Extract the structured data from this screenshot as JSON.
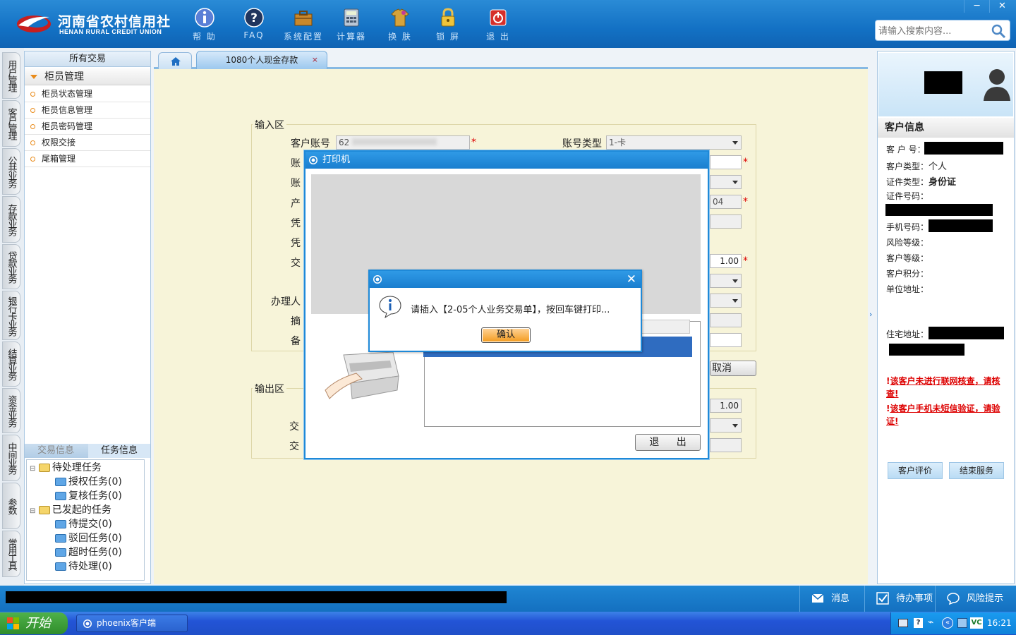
{
  "header": {
    "logo_cn": "河南省农村信用社",
    "logo_en": "HENAN RURAL CREDIT UNION",
    "buttons": [
      {
        "label": "帮 助",
        "icon": "info-icon"
      },
      {
        "label": "FAQ",
        "icon": "help-question-icon"
      },
      {
        "label": "系统配置",
        "icon": "toolbox-icon"
      },
      {
        "label": "计算器",
        "icon": "calculator-icon"
      },
      {
        "label": "换 肤",
        "icon": "shirt-icon"
      },
      {
        "label": "锁 屏",
        "icon": "lock-icon"
      },
      {
        "label": "退 出",
        "icon": "power-icon"
      }
    ],
    "window_controls": {
      "minimize": "─",
      "close": "✕"
    },
    "search_placeholder": "请输入搜索内容..."
  },
  "vtabs": [
    "用户管理",
    "客户管理",
    "公共业务",
    "存款业务",
    "贷款业务",
    "银行卡业务",
    "结算业务",
    "资金业务",
    "中间业务",
    "参数",
    "常用工具"
  ],
  "left_panel": {
    "header": "所有交易",
    "group": "柜员管理",
    "items": [
      "柜员状态管理",
      "柜员信息管理",
      "柜员密码管理",
      "权限交接",
      "尾箱管理"
    ],
    "bottom_tabs": [
      "交易信息",
      "任务信息"
    ],
    "tree": {
      "pending": {
        "label": "待处理任务",
        "children": [
          "授权任务(0)",
          "复核任务(0)"
        ]
      },
      "initiated": {
        "label": "已发起的任务",
        "children": [
          "待提交(0)",
          "驳回任务(0)",
          "超时任务(0)",
          "待处理(0)"
        ]
      }
    }
  },
  "tabs": {
    "current": "1080个人现金存款",
    "close": "×"
  },
  "form": {
    "input_legend": "输入区",
    "output_legend": "输出区",
    "account_label": "客户账号",
    "account_value": "62",
    "account_type_label": "账号类型",
    "account_type_value": "1-卡",
    "partial_labels": [
      "账",
      "账",
      "产",
      "凭",
      "凭",
      "交",
      "办理人"
    ],
    "partial_labels2": [
      "摘",
      "备"
    ],
    "product_tail": "04",
    "amount": "1.00",
    "cancel": "取消",
    "out_labels": [
      "交",
      "交"
    ],
    "out_amount": "1.00"
  },
  "printer_dialog": {
    "title": "打印机",
    "exit": "退 出"
  },
  "message_dialog": {
    "text": "请插入【2-05个人业务交易单】，按回车键打印...",
    "ok": "确认",
    "close": "✕"
  },
  "right_panel": {
    "header": "客户信息",
    "fields": [
      {
        "label": "客 户 号：",
        "value": ""
      },
      {
        "label": "客户类型：",
        "value": "个人"
      },
      {
        "label": "证件类型：",
        "value": "身份证"
      },
      {
        "label": "证件号码：",
        "value": ""
      },
      {
        "label": "手机号码：",
        "value": ""
      },
      {
        "label": "风险等级：",
        "value": ""
      },
      {
        "label": "客户等级：",
        "value": ""
      },
      {
        "label": "客户积分：",
        "value": ""
      },
      {
        "label": "单位地址：",
        "value": ""
      },
      {
        "label": "住宅地址：",
        "value": ""
      }
    ],
    "warn1": "该客户未进行联网核查，请核查!",
    "warn2": "该客户手机未短信验证，请验证!",
    "warn_prefix": "!",
    "buttons": [
      "客户评价",
      "结束服务"
    ]
  },
  "statusbar": {
    "buttons": [
      "消息",
      "待办事项",
      "风险提示"
    ]
  },
  "taskbar": {
    "start": "开始",
    "task": "phoenix客户端",
    "time": "16:21",
    "vc": "VC"
  },
  "colors": {
    "header_blue": "#1371c4",
    "content_bg": "#f7f4d9",
    "warning_red": "#dd0000",
    "ok_orange": "#f39a1c"
  }
}
